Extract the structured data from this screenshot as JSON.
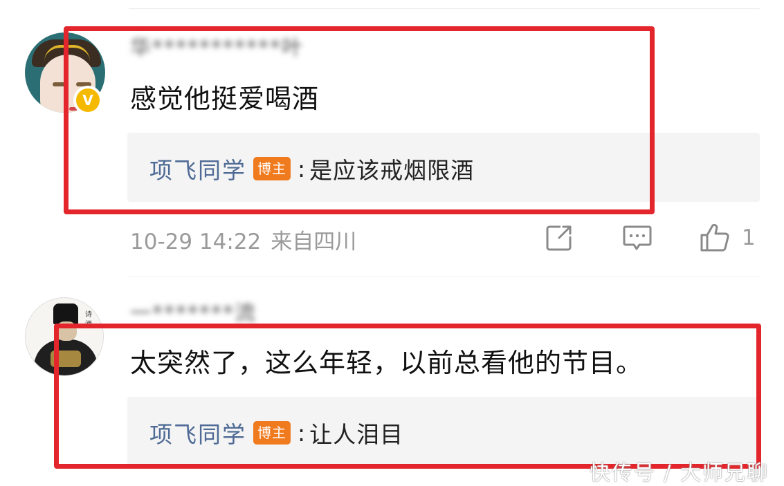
{
  "comments": [
    {
      "username": "华***********叶",
      "text": "感觉他挺爱喝酒",
      "reply": {
        "author": "项飞同学",
        "badge": "博主",
        "separator": ":",
        "text": "是应该戒烟限酒"
      },
      "timestamp": "10-29 14:22",
      "location": "来自四川",
      "like_count": "1"
    },
    {
      "username": "一*******流",
      "text": "太突然了，这么年轻，以前总看他的节目。",
      "reply": {
        "author": "项飞同学",
        "badge": "博主",
        "separator": ":",
        "text": "让人泪目"
      }
    }
  ],
  "verified_badge": "V",
  "avatar_2_calligraphy": "诗酒",
  "watermark": "快传号 / 大师兄聊",
  "colors": {
    "highlight": "#e3262b",
    "author_link": "#4e6a95",
    "badge": "#f07b1f",
    "verified": "#f5b900",
    "meta": "#9a9a9a"
  },
  "icons": [
    "share-icon",
    "comment-icon",
    "like-icon"
  ]
}
